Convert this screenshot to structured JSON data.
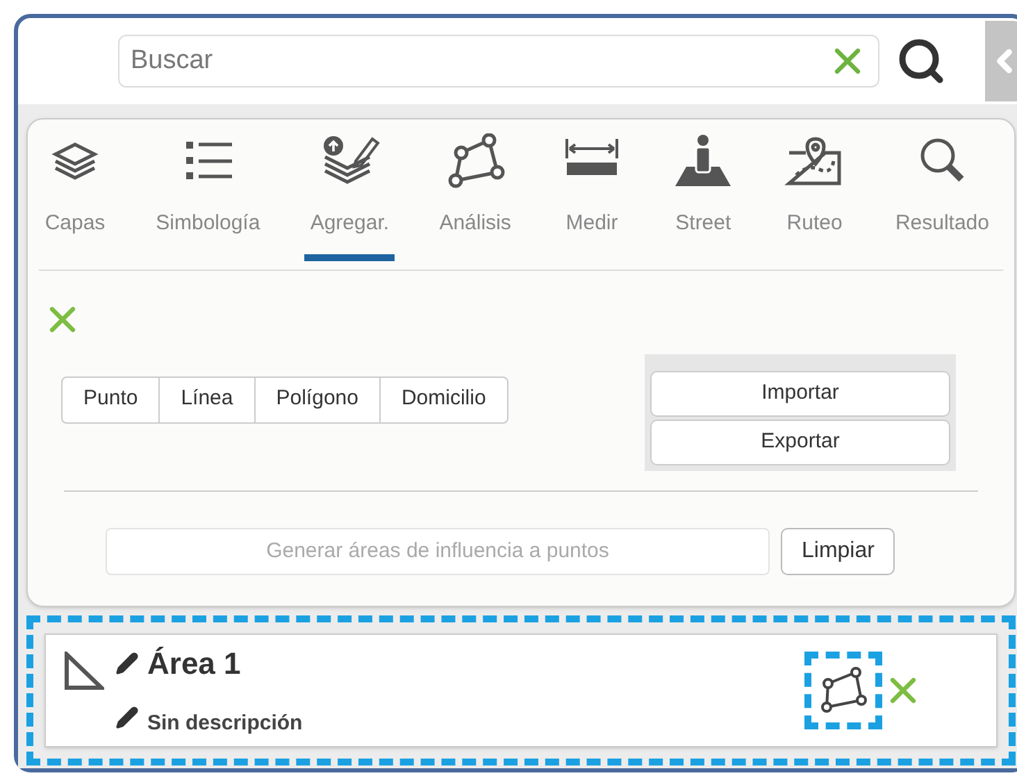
{
  "search": {
    "placeholder": "Buscar"
  },
  "tabs": [
    {
      "label": "Capas",
      "kind": "layers",
      "selected": false
    },
    {
      "label": "Simbología",
      "kind": "legend",
      "selected": false
    },
    {
      "label": "Agregar.",
      "kind": "add",
      "selected": true
    },
    {
      "label": "Análisis",
      "kind": "polygon",
      "selected": false
    },
    {
      "label": "Medir",
      "kind": "ruler",
      "selected": false
    },
    {
      "label": "Street",
      "kind": "street",
      "selected": false
    },
    {
      "label": "Ruteo",
      "kind": "route",
      "selected": false
    },
    {
      "label": "Resultado",
      "kind": "search",
      "selected": false
    }
  ],
  "draw_types": [
    "Punto",
    "Línea",
    "Polígono",
    "Domicilio"
  ],
  "file_buttons": [
    "Importar",
    "Exportar"
  ],
  "buffer": {
    "placeholder": "Generar áreas de influencia a puntos",
    "button": "Limpiar"
  },
  "feature": {
    "title": "Área 1",
    "description": "Sin descripción",
    "highlighted": true,
    "edit_highlighted": true
  }
}
